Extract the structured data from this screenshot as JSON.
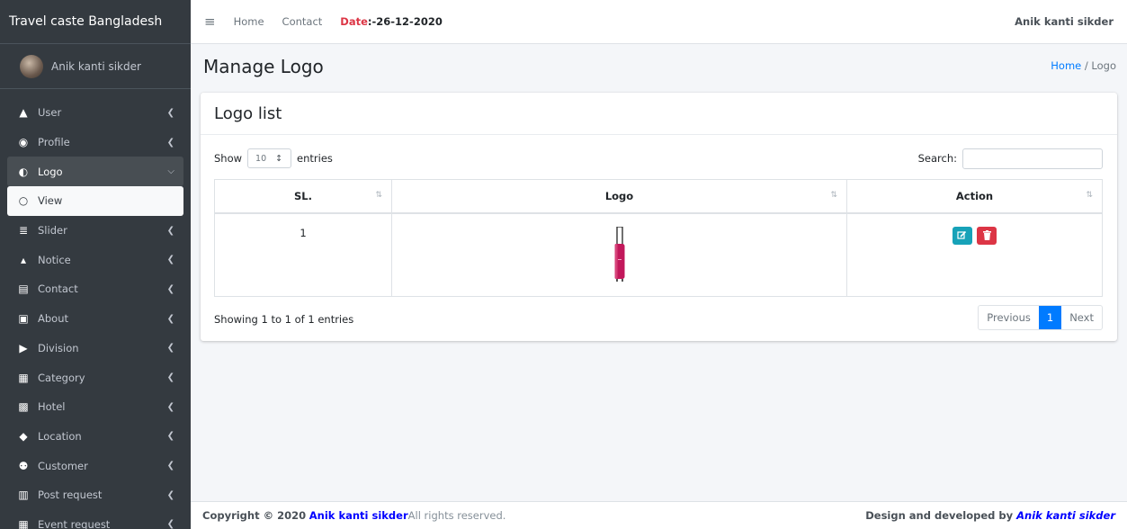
{
  "sidebar": {
    "brand": "Travel caste Bangladesh",
    "user_name": "Anik kanti sikder",
    "items": [
      {
        "label": "User",
        "icon": "user-icon",
        "glyph": "▲"
      },
      {
        "label": "Profile",
        "icon": "profile-icon",
        "glyph": "◉"
      },
      {
        "label": "Logo",
        "icon": "logo-icon",
        "glyph": "◐"
      },
      {
        "label": "View",
        "icon": "circle-outline-icon",
        "glyph": "○"
      },
      {
        "label": "Slider",
        "icon": "sliders-icon",
        "glyph": "≣"
      },
      {
        "label": "Notice",
        "icon": "bell-icon",
        "glyph": "▴"
      },
      {
        "label": "Contact",
        "icon": "contact-card-icon",
        "glyph": "▤"
      },
      {
        "label": "About",
        "icon": "id-card-icon",
        "glyph": "▣"
      },
      {
        "label": "Division",
        "icon": "flag-icon",
        "glyph": "▶"
      },
      {
        "label": "Category",
        "icon": "list-box-icon",
        "glyph": "▦"
      },
      {
        "label": "Hotel",
        "icon": "hotel-icon",
        "glyph": "▩"
      },
      {
        "label": "Location",
        "icon": "map-marker-icon",
        "glyph": "◆"
      },
      {
        "label": "Customer",
        "icon": "users-icon",
        "glyph": "⚉"
      },
      {
        "label": "Post request",
        "icon": "building-icon",
        "glyph": "▥"
      },
      {
        "label": "Event request",
        "icon": "calendar-icon",
        "glyph": "▦"
      }
    ]
  },
  "topbar": {
    "menu_icon": "hamburger-icon",
    "home": "Home",
    "contact": "Contact",
    "date_key": "Date",
    "date_value": ":-26-12-2020",
    "user": "Anik kanti sikder"
  },
  "header": {
    "title": "Manage Logo",
    "breadcrumb_home": "Home",
    "breadcrumb_sep": " / ",
    "breadcrumb_current": "Logo"
  },
  "card": {
    "title": "Logo list",
    "show": "Show",
    "entries_value": "10",
    "entries": "entries",
    "search_label": "Search:",
    "search_value": "",
    "columns": [
      "SL.",
      "Logo",
      "Action"
    ],
    "rows": [
      {
        "sl": "1",
        "logo_icon": "suitcase-image"
      }
    ],
    "info": "Showing 1 to 1 of 1 entries",
    "pagination": {
      "previous": "Previous",
      "current": "1",
      "next": "Next"
    }
  },
  "footer": {
    "copyright": "Copyright © 2020 ",
    "author": "Anik kanti sikder",
    "rights": " All rights reserved.",
    "design_prefix": "Design and developed by ",
    "designer": "Anik kanti sikder"
  },
  "colors": {
    "sidebar_bg": "#343a40",
    "primary": "#007bff",
    "edit": "#17a2b8",
    "delete": "#dc3545",
    "suitcase": "#c2185b"
  }
}
